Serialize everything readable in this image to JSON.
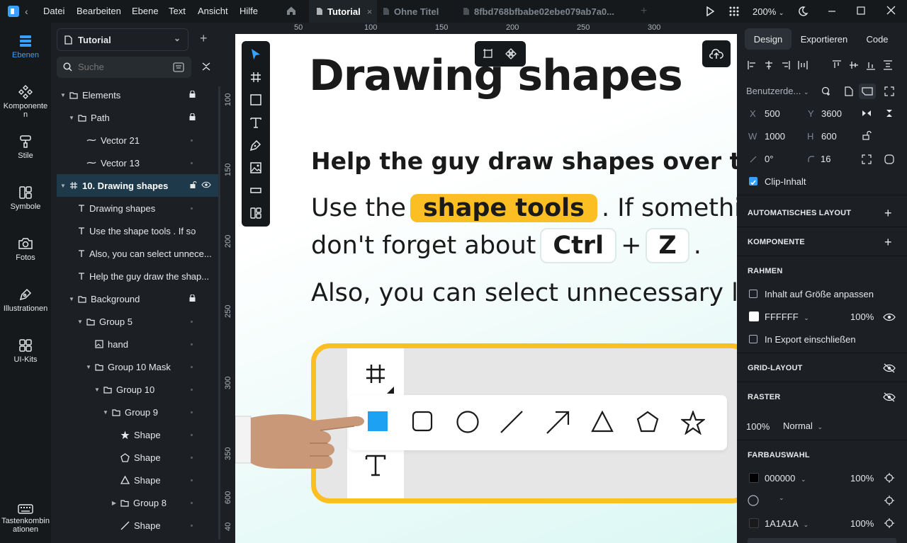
{
  "menu": [
    "Datei",
    "Bearbeiten",
    "Ebene",
    "Text",
    "Ansicht",
    "Hilfe"
  ],
  "tabs": [
    {
      "label": "Tutorial",
      "active": true
    },
    {
      "label": "Ohne Titel",
      "active": false
    },
    {
      "label": "8fbd768bfbabe02ebe079ab7a0...",
      "active": false
    }
  ],
  "zoom": "200%",
  "rail": [
    {
      "label": "Ebenen",
      "icon": "layers-icon",
      "active": true
    },
    {
      "label": "Komponenten",
      "icon": "components-icon"
    },
    {
      "label": "Stile",
      "icon": "brush-icon"
    },
    {
      "label": "Symbole",
      "icon": "symbols-icon"
    },
    {
      "label": "Fotos",
      "icon": "camera-icon"
    },
    {
      "label": "Illustrationen",
      "icon": "pen-icon"
    },
    {
      "label": "UI-Kits",
      "icon": "ui-kits-icon"
    },
    {
      "label": "Tastenkombinationen",
      "icon": "keyboard-icon"
    }
  ],
  "file": {
    "name": "Tutorial"
  },
  "search": {
    "placeholder": "Suche"
  },
  "layers": [
    {
      "label": "Elements",
      "type": "folder",
      "depth": 0,
      "expanded": true,
      "locked": true
    },
    {
      "label": "Path",
      "type": "folder",
      "depth": 1,
      "expanded": true,
      "locked": true
    },
    {
      "label": "Vector 21",
      "type": "vector",
      "depth": 2
    },
    {
      "label": "Vector 13",
      "type": "vector",
      "depth": 2
    },
    {
      "label": "10. Drawing shapes",
      "type": "frame",
      "depth": 0,
      "expanded": true,
      "selected": true
    },
    {
      "label": "Drawing shapes",
      "type": "text",
      "depth": 1
    },
    {
      "label": "Use the   shape tools  . If so",
      "type": "text",
      "depth": 1
    },
    {
      "label": "Also, you can select unnece...",
      "type": "text",
      "depth": 1
    },
    {
      "label": "Help the guy draw the shap...",
      "type": "text",
      "depth": 1
    },
    {
      "label": "Background",
      "type": "folder",
      "depth": 1,
      "expanded": true,
      "locked": true
    },
    {
      "label": "Group 5",
      "type": "folder",
      "depth": 2,
      "expanded": true
    },
    {
      "label": "hand",
      "type": "image",
      "depth": 3
    },
    {
      "label": "Group 10 Mask",
      "type": "folder",
      "depth": 3,
      "expanded": true
    },
    {
      "label": "Group 10",
      "type": "folder",
      "depth": 4,
      "expanded": true
    },
    {
      "label": "Group 9",
      "type": "folder",
      "depth": 5,
      "expanded": true
    },
    {
      "label": "Shape",
      "type": "star",
      "depth": 6
    },
    {
      "label": "Shape",
      "type": "pentagon",
      "depth": 6
    },
    {
      "label": "Shape",
      "type": "triangle",
      "depth": 6
    },
    {
      "label": "Group 8",
      "type": "folder",
      "depth": 6
    },
    {
      "label": "Shape",
      "type": "line",
      "depth": 6
    }
  ],
  "rulers": {
    "top": [
      "50",
      "100",
      "150",
      "200",
      "250",
      "300"
    ],
    "left": [
      "100",
      "150",
      "200",
      "250",
      "300",
      "350",
      "600",
      "40"
    ]
  },
  "canvas": {
    "title": "Drawing shapes",
    "help": "Help the guy draw shapes over the",
    "line1_a": "Use the",
    "line1_hl": "shape tools",
    "line1_b": ". If something",
    "line2_a": "don't forget about",
    "key1": "Ctrl",
    "plus": "+",
    "key2": "Z",
    "line2_b": ".",
    "line3": "Also, you can select unnecessary la"
  },
  "right": {
    "tabs": [
      "Design",
      "Exportieren",
      "Code"
    ],
    "preset": "Benutzerde...",
    "x": "500",
    "y": "3600",
    "w": "1000",
    "h": "600",
    "rotation": "0°",
    "radius": "16",
    "clip": "Clip-Inhalt",
    "sections": {
      "auto_layout": "AUTOMATISCHES LAYOUT",
      "component": "KOMPONENTE",
      "frame": "RAHMEN",
      "grid_layout": "GRID-LAYOUT",
      "raster": "RASTER",
      "colors": "FARBAUSWAHL"
    },
    "fit": "Inhalt auf Größe anpassen",
    "fill_hex": "FFFFFF",
    "fill_opacity": "100%",
    "export_include": "In Export einschließen",
    "raster_opacity": "100%",
    "raster_mode": "Normal",
    "colors": [
      {
        "hex": "000000",
        "opacity": "100%",
        "swatch": "#000000"
      },
      {
        "hex": "",
        "opacity": "",
        "swatch": "circle"
      },
      {
        "hex": "1A1A1A",
        "opacity": "100%",
        "swatch": "#1A1A1A"
      }
    ]
  },
  "accent": "#3aa0ff",
  "highlight": "#fbbf24"
}
